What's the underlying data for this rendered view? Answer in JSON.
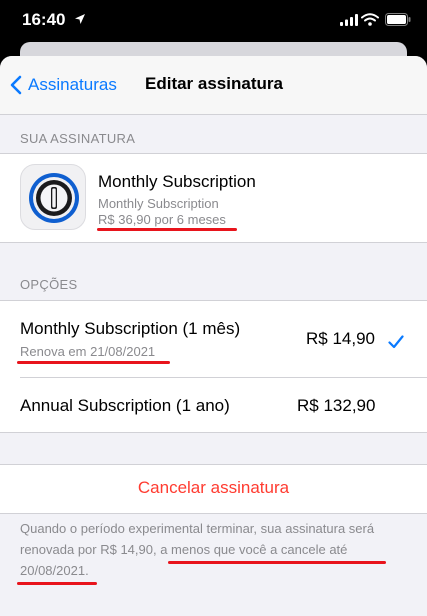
{
  "status_bar": {
    "time": "16:40",
    "icons": [
      "location-arrow-icon",
      "signal-icon",
      "wifi-icon",
      "battery-icon"
    ]
  },
  "nav": {
    "back_label": "Assinaturas",
    "title": "Editar assinatura"
  },
  "current_subscription": {
    "section_header": "SUA ASSINATURA",
    "app_icon": "1password-keyhole-icon",
    "title": "Monthly Subscription",
    "subtitle": "Monthly Subscription",
    "price_line": "R$ 36,90 por 6 meses"
  },
  "options": {
    "section_header": "OPÇÕES",
    "items": [
      {
        "label": "Monthly Subscription (1 mês)",
        "sub": "Renova em 21/08/2021",
        "price": "R$ 14,90",
        "selected": true
      },
      {
        "label": "Annual Subscription (1 ano)",
        "sub": "",
        "price": "R$ 132,90",
        "selected": false
      }
    ]
  },
  "cancel": {
    "label": "Cancelar assinatura"
  },
  "footer": {
    "part1": "Quando o período experimental terminar, sua assinatura será renovada por R$ 14,90, ",
    "part2": "a menos que você a cancele até",
    "part3": " 20/08/2021."
  },
  "colors": {
    "accent": "#0a7aff",
    "destructive": "#ff3b30",
    "annotation": "#e8141c",
    "secondary_text": "#8a8a8e",
    "background": "#f2f2f7"
  }
}
